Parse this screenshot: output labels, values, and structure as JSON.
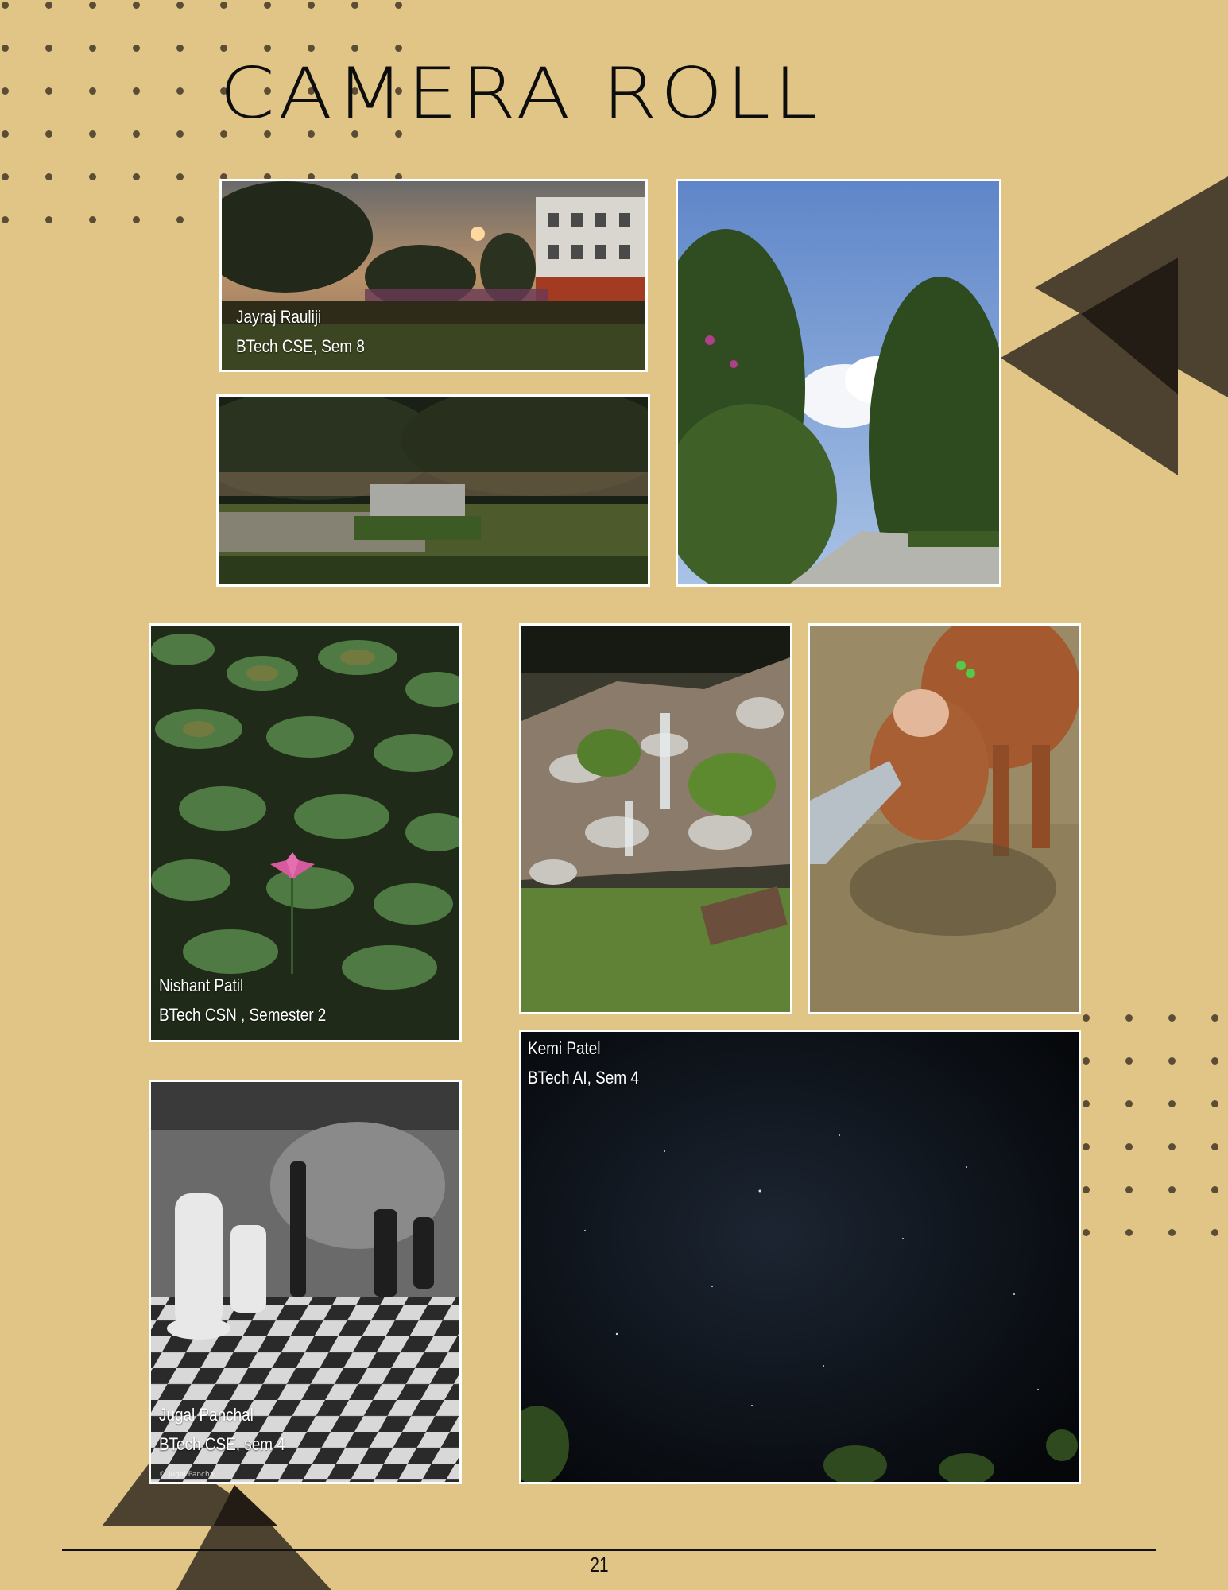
{
  "page": {
    "title": "CAMERA ROLL",
    "page_number": "21",
    "background": "#e0c587",
    "accent_dark": "#4d4130"
  },
  "photos": [
    {
      "id": "courtyard-sunset",
      "name": "Jayraj Rauliji",
      "detail": "BTech CSE, Sem 8"
    },
    {
      "id": "garden-sculpture"
    },
    {
      "id": "tree-lined-road"
    },
    {
      "id": "lotus-pond",
      "name": "Nishant Patil",
      "detail": "BTech CSN , Semester 2"
    },
    {
      "id": "rock-waterfall"
    },
    {
      "id": "petting-calf"
    },
    {
      "id": "chess-board",
      "name": "Jugal Panchal",
      "detail": "BTech CSE, sem 4",
      "credit": "© Jugal Panchal"
    },
    {
      "id": "night-sky",
      "name": "Kemi Patel",
      "detail": "BTech AI, Sem 4"
    }
  ]
}
